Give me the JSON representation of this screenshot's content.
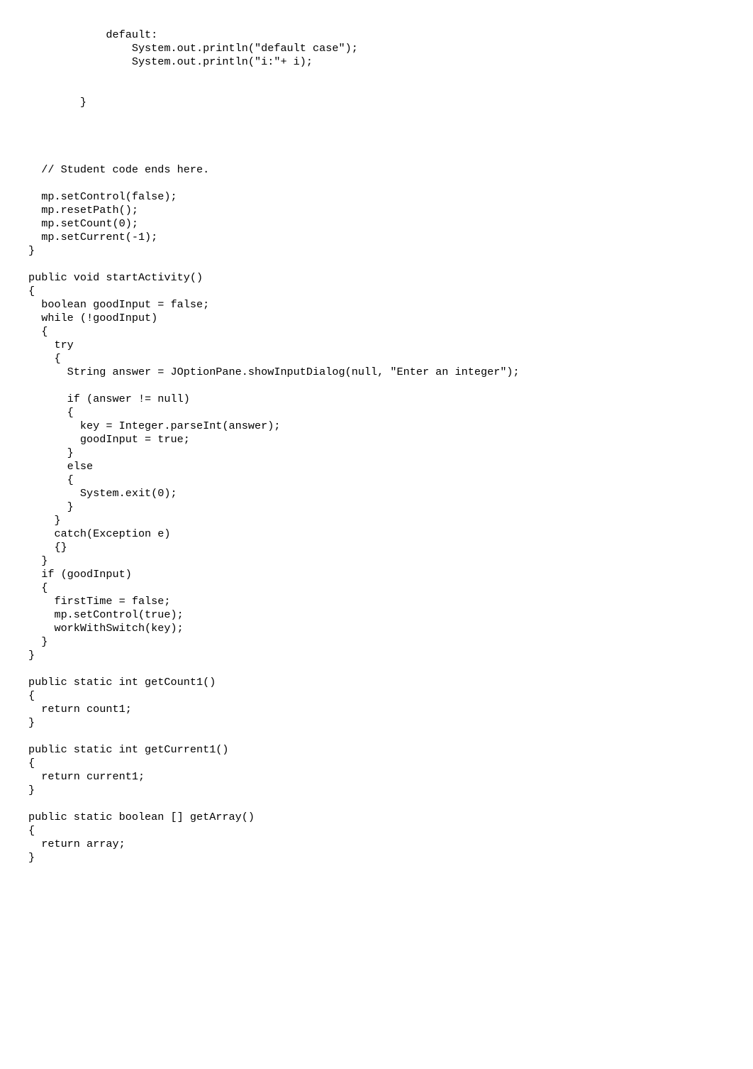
{
  "code": {
    "text": "            default:\n                System.out.println(\"default case\");\n                System.out.println(\"i:\"+ i);\n\n\n        }\n\n\n\n\n  // Student code ends here.\n\n  mp.setControl(false);\n  mp.resetPath();\n  mp.setCount(0);\n  mp.setCurrent(-1);\n}\n\npublic void startActivity()\n{\n  boolean goodInput = false;\n  while (!goodInput)\n  {\n    try\n    {\n      String answer = JOptionPane.showInputDialog(null, \"Enter an integer\");\n\n      if (answer != null)\n      {\n        key = Integer.parseInt(answer);\n        goodInput = true;\n      }\n      else\n      {\n        System.exit(0);\n      }\n    }\n    catch(Exception e)\n    {}\n  }\n  if (goodInput)\n  {\n    firstTime = false;\n    mp.setControl(true);\n    workWithSwitch(key);\n  }\n}\n\npublic static int getCount1()\n{\n  return count1;\n}\n\npublic static int getCurrent1()\n{\n  return current1;\n}\n\npublic static boolean [] getArray()\n{\n  return array;\n}"
  }
}
